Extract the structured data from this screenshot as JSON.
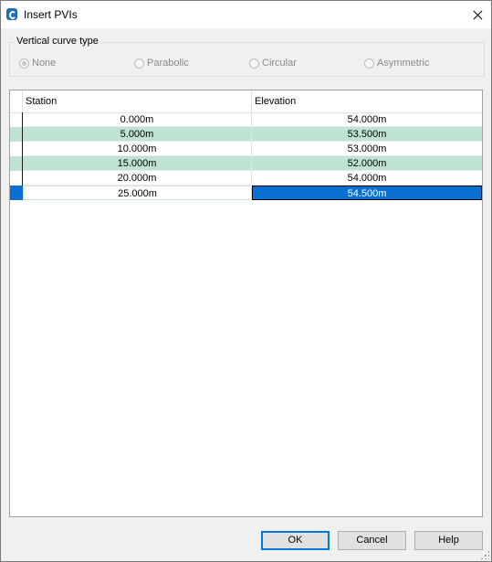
{
  "window": {
    "title": "Insert PVIs"
  },
  "curve_type": {
    "label": "Vertical curve type",
    "options": [
      {
        "label": "None",
        "checked": true
      },
      {
        "label": "Parabolic",
        "checked": false
      },
      {
        "label": "Circular",
        "checked": false
      },
      {
        "label": "Asymmetric",
        "checked": false
      }
    ]
  },
  "table": {
    "columns": [
      "Station",
      "Elevation"
    ],
    "rows": [
      {
        "station": "0.000m",
        "elevation": "54.000m"
      },
      {
        "station": "5.000m",
        "elevation": "53.500m"
      },
      {
        "station": "10.000m",
        "elevation": "53.000m"
      },
      {
        "station": "15.000m",
        "elevation": "52.000m"
      },
      {
        "station": "20.000m",
        "elevation": "54.000m"
      },
      {
        "station": "25.000m",
        "elevation": "54.500m"
      }
    ]
  },
  "buttons": {
    "ok": "OK",
    "cancel": "Cancel",
    "help": "Help"
  },
  "colors": {
    "alt_row": "#bfe3d3",
    "selection": "#0a6fd3",
    "default_button_border": "#0078d7"
  }
}
